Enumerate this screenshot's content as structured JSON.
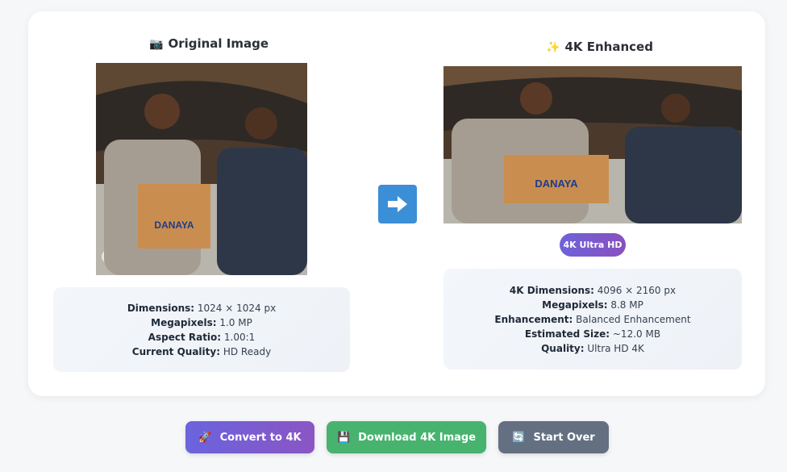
{
  "original": {
    "title": "Original Image",
    "title_icon": "📷",
    "details": [
      {
        "label": "Dimensions:",
        "value": "1024 × 1024 px"
      },
      {
        "label": "Megapixels:",
        "value": "1.0 MP"
      },
      {
        "label": "Aspect Ratio:",
        "value": "1.00:1"
      },
      {
        "label": "Current Quality:",
        "value": "HD Ready"
      }
    ]
  },
  "enhanced": {
    "title": "4K Enhanced",
    "title_icon": "✨",
    "badge": "4K Ultra HD",
    "details": [
      {
        "label": "4K Dimensions:",
        "value": "4096 × 2160 px"
      },
      {
        "label": "Megapixels:",
        "value": "8.8 MP"
      },
      {
        "label": "Enhancement:",
        "value": "Balanced Enhancement"
      },
      {
        "label": "Estimated Size:",
        "value": "~12.0 MB"
      },
      {
        "label": "Quality:",
        "value": "Ultra HD 4K"
      }
    ]
  },
  "photo_brand": "DANAYA",
  "buttons": {
    "convert": {
      "label": "Convert to 4K",
      "icon": "🚀"
    },
    "download": {
      "label": "Download 4K Image",
      "icon": "💾"
    },
    "restart": {
      "label": "Start Over",
      "icon": "🔄"
    }
  },
  "colors": {
    "accent_blue": "#3b8fd6",
    "convert_start": "#6a64de",
    "convert_end": "#8b55c4",
    "download_green": "#47b36f",
    "restart_gray": "#647081"
  }
}
